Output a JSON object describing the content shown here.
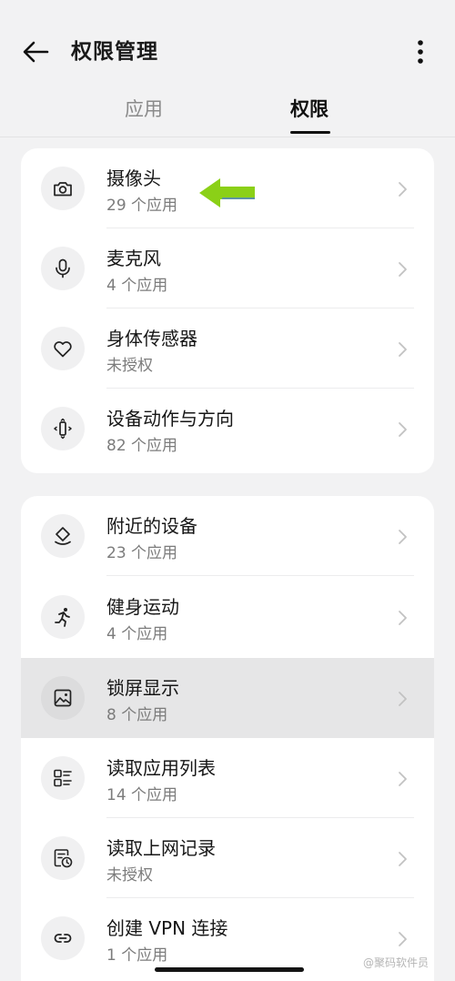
{
  "header": {
    "title": "权限管理",
    "back_icon": "arrow-left-icon",
    "more_icon": "vertical-dots-icon"
  },
  "tabs": [
    {
      "label": "应用",
      "active": false
    },
    {
      "label": "权限",
      "active": true
    }
  ],
  "groups": [
    {
      "items": [
        {
          "label": "摄像头",
          "sub": "29 个应用",
          "icon": "camera-icon"
        },
        {
          "label": "麦克风",
          "sub": "4 个应用",
          "icon": "microphone-icon"
        },
        {
          "label": "身体传感器",
          "sub": "未授权",
          "icon": "heart-icon"
        },
        {
          "label": "设备动作与方向",
          "sub": "82 个应用",
          "icon": "device-motion-icon"
        }
      ]
    },
    {
      "items": [
        {
          "label": "附近的设备",
          "sub": "23 个应用",
          "icon": "nearby-devices-icon"
        },
        {
          "label": "健身运动",
          "sub": "4 个应用",
          "icon": "running-figure-icon"
        },
        {
          "label": "锁屏显示",
          "sub": "8 个应用",
          "icon": "lock-screen-image-icon",
          "pressed": true
        },
        {
          "label": "读取应用列表",
          "sub": "14 个应用",
          "icon": "app-list-icon"
        },
        {
          "label": "读取上网记录",
          "sub": "未授权",
          "icon": "browsing-history-icon"
        },
        {
          "label": "创建 VPN 连接",
          "sub": "1 个应用",
          "icon": "link-icon"
        }
      ]
    }
  ],
  "annotation": {
    "icon": "green-arrow-icon",
    "color": "#8bd017"
  },
  "watermark": "@聚码软件员",
  "colors": {
    "background": "#f2f2f3",
    "card": "#ffffff",
    "pressed_row": "#e6e6e7",
    "secondary_text": "#7c7c7c"
  }
}
